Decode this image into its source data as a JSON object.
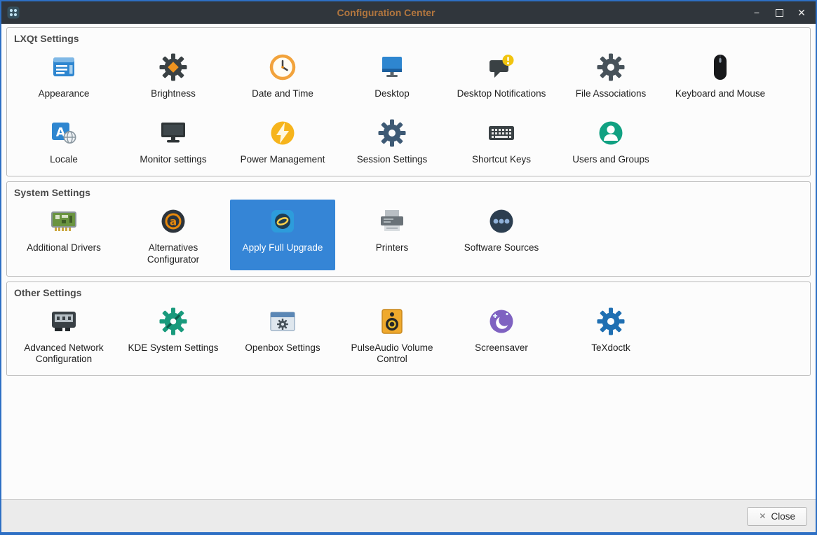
{
  "window": {
    "title": "Configuration Center",
    "controls": {
      "minimize": "−",
      "close": "✕"
    }
  },
  "colors": {
    "selection": "#3585d6",
    "titlebar": "#30363c",
    "title_text": "#b2763e",
    "window_border": "#2d6fc4"
  },
  "sections": [
    {
      "title": "LXQt Settings",
      "items": [
        {
          "label": "Appearance",
          "icon": "appearance-icon"
        },
        {
          "label": "Brightness",
          "icon": "brightness-icon"
        },
        {
          "label": "Date and Time",
          "icon": "date-time-icon"
        },
        {
          "label": "Desktop",
          "icon": "desktop-icon"
        },
        {
          "label": "Desktop Notifications",
          "icon": "desktop-notifications-icon"
        },
        {
          "label": "File Associations",
          "icon": "file-associations-icon"
        },
        {
          "label": "Keyboard and Mouse",
          "icon": "keyboard-mouse-icon"
        },
        {
          "label": "Locale",
          "icon": "locale-icon"
        },
        {
          "label": "Monitor settings",
          "icon": "monitor-settings-icon"
        },
        {
          "label": "Power Management",
          "icon": "power-management-icon"
        },
        {
          "label": "Session Settings",
          "icon": "session-settings-icon"
        },
        {
          "label": "Shortcut Keys",
          "icon": "shortcut-keys-icon"
        },
        {
          "label": "Users and Groups",
          "icon": "users-groups-icon"
        }
      ]
    },
    {
      "title": "System Settings",
      "items": [
        {
          "label": "Additional Drivers",
          "icon": "additional-drivers-icon"
        },
        {
          "label": "Alternatives Configurator",
          "icon": "alternatives-configurator-icon"
        },
        {
          "label": "Apply Full Upgrade",
          "icon": "apply-full-upgrade-icon",
          "selected": true
        },
        {
          "label": "Printers",
          "icon": "printers-icon"
        },
        {
          "label": "Software Sources",
          "icon": "software-sources-icon"
        }
      ]
    },
    {
      "title": "Other Settings",
      "items": [
        {
          "label": "Advanced Network Configuration",
          "icon": "advanced-network-icon"
        },
        {
          "label": "KDE System Settings",
          "icon": "kde-system-settings-icon"
        },
        {
          "label": "Openbox Settings",
          "icon": "openbox-settings-icon"
        },
        {
          "label": "PulseAudio Volume Control",
          "icon": "pulseaudio-icon"
        },
        {
          "label": "Screensaver",
          "icon": "screensaver-icon"
        },
        {
          "label": "TeXdoctk",
          "icon": "texdoctk-icon"
        }
      ]
    }
  ],
  "footer": {
    "close_label": "Close",
    "close_icon": "✕"
  }
}
